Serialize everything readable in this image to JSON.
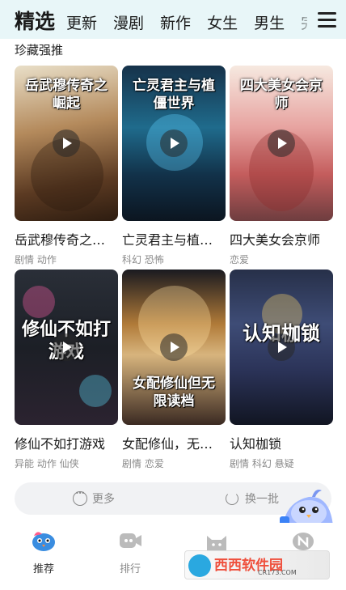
{
  "top_tabs": {
    "items": [
      "精选",
      "更新",
      "漫剧",
      "新作",
      "女生",
      "男生",
      "完"
    ]
  },
  "section": {
    "title": "珍藏强推"
  },
  "cards": [
    {
      "cover_title": "岳武穆传奇之崛起",
      "name": "岳武穆传奇之…",
      "tags": "剧情 动作"
    },
    {
      "cover_title": "亡灵君主与植僵世界",
      "name": "亡灵君主与植…",
      "tags": "科幻 恐怖"
    },
    {
      "cover_title": "四大美女会京师",
      "name": "四大美女会京师",
      "tags": "恋爱"
    },
    {
      "cover_title": "修仙不如打游戏",
      "name": "修仙不如打游戏",
      "tags": "异能 动作 仙侠"
    },
    {
      "cover_title": "女配修仙但无限读档",
      "name": "女配修仙，无…",
      "tags": "剧情 恋爱"
    },
    {
      "cover_title": "认知枷锁",
      "name": "认知枷锁",
      "tags": "剧情 科幻 悬疑"
    }
  ],
  "more_bar": {
    "more_label": "更多",
    "refresh_label": "换一批"
  },
  "bottom_nav": {
    "items": [
      {
        "label": "推荐",
        "icon": "bird-mascot-icon",
        "color": "#3a8de0"
      },
      {
        "label": "排行",
        "icon": "video-camera-icon",
        "color": "#bbbbbb"
      },
      {
        "label": "",
        "icon": "cat-icon",
        "color": "#bbbbbb"
      },
      {
        "label": "",
        "icon": "n-profile-icon",
        "color": "#bbbbbb"
      }
    ]
  },
  "watermark": {
    "brand": "西西软件园",
    "url": "CR173.COM"
  },
  "colors": {
    "topbar": "#e8f6f8",
    "watermark_red": "#ef4f3c",
    "watermark_blue": "#1f8fd6"
  }
}
